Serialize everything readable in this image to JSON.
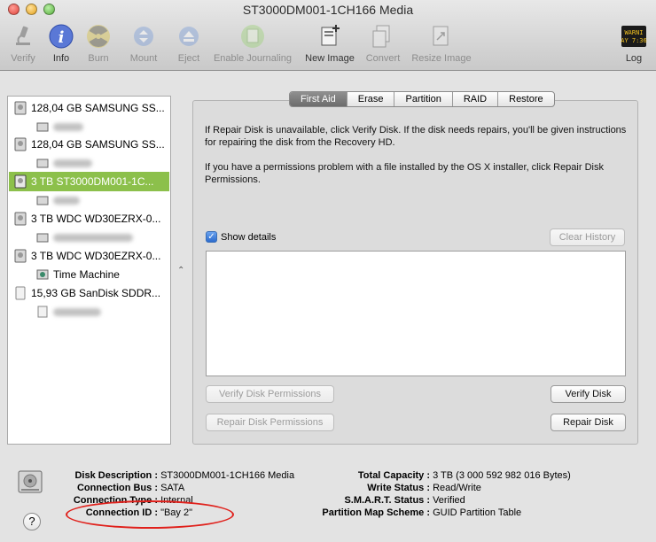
{
  "window": {
    "title": "ST3000DM001-1CH166 Media"
  },
  "toolbar": {
    "verify": "Verify",
    "info": "Info",
    "burn": "Burn",
    "mount": "Mount",
    "eject": "Eject",
    "enable_journaling": "Enable Journaling",
    "new_image": "New Image",
    "convert": "Convert",
    "resize_image": "Resize Image",
    "log": "Log",
    "log_icon_text_1": "WARNI",
    "log_icon_text_2": "AY 7:36"
  },
  "sidebar": {
    "disks": [
      {
        "label": "128,04 GB SAMSUNG SS..."
      },
      {
        "label": "128,04 GB SAMSUNG SS..."
      },
      {
        "label": "3 TB ST3000DM001-1C...",
        "selected": true
      },
      {
        "label": "3 TB WDC WD30EZRX-0..."
      },
      {
        "label": "3 TB WDC WD30EZRX-0..."
      },
      {
        "label": "15,93 GB SanDisk SDDR..."
      }
    ],
    "volume_time_machine": "Time Machine"
  },
  "tabs": [
    "First Aid",
    "Erase",
    "Partition",
    "RAID",
    "Restore"
  ],
  "first_aid": {
    "para1": "If Repair Disk is unavailable, click Verify Disk. If the disk needs repairs, you'll be given instructions for repairing the disk from the Recovery HD.",
    "para2": "If you have a permissions problem with a file installed by the OS X installer, click Repair Disk Permissions.",
    "show_details": "Show details",
    "clear_history": "Clear History",
    "verify_permissions": "Verify Disk Permissions",
    "repair_permissions": "Repair Disk Permissions",
    "verify_disk": "Verify Disk",
    "repair_disk": "Repair Disk"
  },
  "info": {
    "disk_description_k": "Disk Description :",
    "disk_description_v": "ST3000DM001-1CH166 Media",
    "connection_bus_k": "Connection Bus :",
    "connection_bus_v": "SATA",
    "connection_type_k": "Connection Type :",
    "connection_type_v": "Internal",
    "connection_id_k": "Connection ID :",
    "connection_id_v": "\"Bay 2\"",
    "total_capacity_k": "Total Capacity :",
    "total_capacity_v": "3 TB (3 000 592 982 016 Bytes)",
    "write_status_k": "Write Status :",
    "write_status_v": "Read/Write",
    "smart_status_k": "S.M.A.R.T. Status :",
    "smart_status_v": "Verified",
    "partition_scheme_k": "Partition Map Scheme :",
    "partition_scheme_v": "GUID Partition Table"
  },
  "help": "?"
}
